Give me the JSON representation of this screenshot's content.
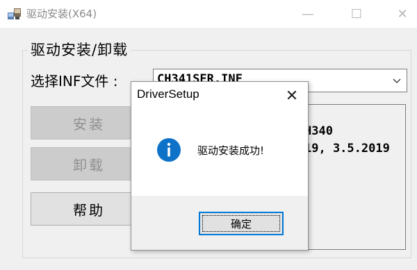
{
  "window": {
    "title": "驱动安装(X64)",
    "controls": {
      "minimize": "—",
      "maximize": "☐",
      "close": "✕"
    }
  },
  "group": {
    "title": "驱动安装/卸载"
  },
  "inf": {
    "label": "选择INF文件 :",
    "selected": "CH341SER.INF"
  },
  "buttons": {
    "install": "安装",
    "uninstall": "卸载",
    "help": "帮助"
  },
  "info": {
    "line1": "H340",
    "line2": "19, 3.5.2019"
  },
  "dialog": {
    "title": "DriverSetup",
    "close": "✕",
    "message": "驱动安装成功!",
    "ok": "确定",
    "icon": "info-icon"
  },
  "colors": {
    "accent": "#0078d7",
    "dialog_icon": "#0d72c8",
    "window_bg": "#f0f0f0"
  }
}
